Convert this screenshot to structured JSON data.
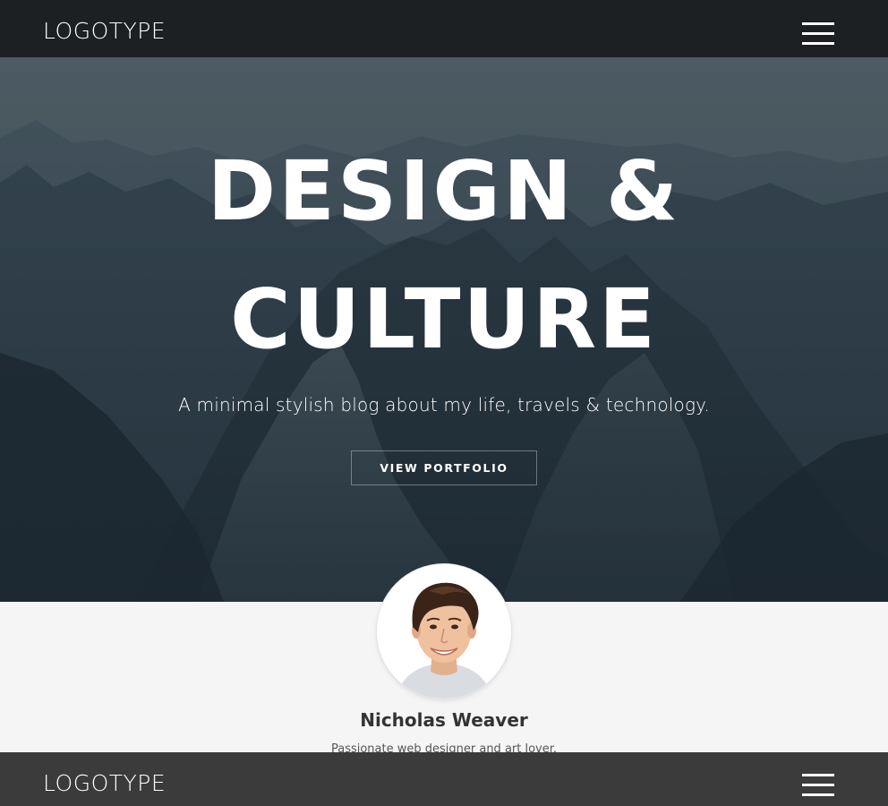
{
  "header": {
    "logo": "LOGOTYPE",
    "menu_icon": "hamburger-menu-icon"
  },
  "hero": {
    "title_line1": "DESIGN &",
    "title_line2": "CULTURE",
    "subtitle": "A minimal stylish blog about my life, travels & technology.",
    "button_label": "VIEW PORTFOLIO"
  },
  "profile": {
    "name": "Nicholas Weaver",
    "bio": "Passionate web designer and art lover."
  },
  "sticky_bar": {
    "logo": "LOGOTYPE",
    "menu_icon": "hamburger-menu-icon"
  },
  "colors": {
    "nav_bg": "#1c2022",
    "sticky_bg": "#3b3b3b",
    "page_bg": "#f5f5f5",
    "text_dark": "#333333"
  }
}
